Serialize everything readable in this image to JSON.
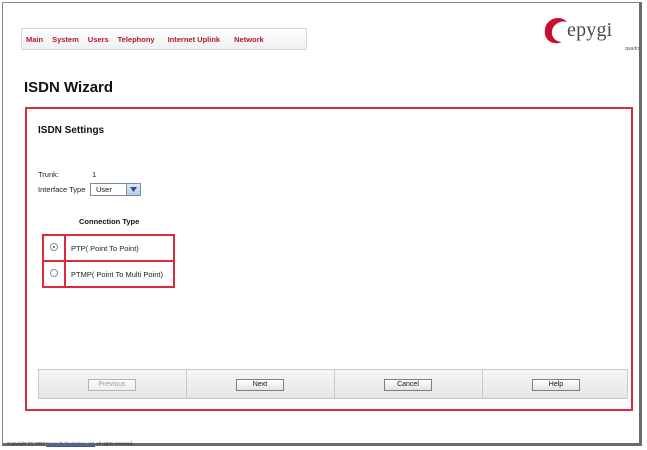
{
  "nav": {
    "items": [
      "Main",
      "System",
      "Users",
      "Telephony",
      "Internet Uplink",
      "Network"
    ]
  },
  "logo": {
    "brand": "epygi",
    "sub": "quadro"
  },
  "page_title": "ISDN Wizard",
  "panel": {
    "section_title": "ISDN Settings",
    "trunk_label": "Trunk:",
    "trunk_value": "1",
    "interface_type_label": "Interface Type",
    "interface_type_value": "User",
    "connection_type_label": "Connection Type",
    "options": [
      {
        "label": "PTP( Point To Point)",
        "selected": true
      },
      {
        "label": "PTMP( Point To Multi Point)",
        "selected": false
      }
    ]
  },
  "buttons": {
    "previous": "Previous",
    "next": "Next",
    "cancel": "Cancel",
    "help": "Help"
  },
  "footer": {
    "prefix": "Copyright (C) 2007 ",
    "company": "Epygi Technologies, Ltd.",
    "suffix": " All rights reserved."
  },
  "colors": {
    "accent": "#d92b3a",
    "nav_text": "#b31a2a",
    "logo_red": "#c8102e"
  }
}
